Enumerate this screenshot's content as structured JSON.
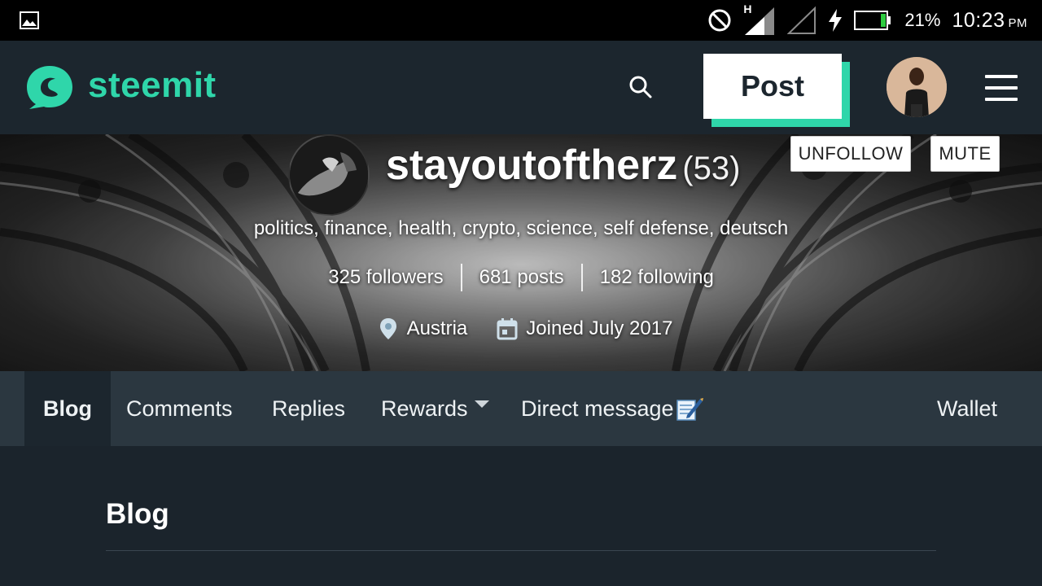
{
  "status_bar": {
    "signal_label": "H",
    "battery_percent": "21%",
    "time": "10:23",
    "ampm": "PM"
  },
  "header": {
    "logo_text": "steemit",
    "post_label": "Post",
    "accent_color": "#2fd6aa"
  },
  "profile": {
    "username": "stayoutoftherz",
    "reputation": "(53)",
    "about": "politics, finance, health, crypto, science, self defense, deutsch",
    "followers": "325 followers",
    "posts": "681 posts",
    "following": "182 following",
    "location": "Austria",
    "joined": "Joined July 2017",
    "unfollow_label": "UNFOLLOW",
    "mute_label": "MUTE"
  },
  "tabs": [
    {
      "label": "Blog"
    },
    {
      "label": "Comments"
    },
    {
      "label": "Replies"
    },
    {
      "label": "Rewards"
    },
    {
      "label": "Direct message"
    },
    {
      "label": "Wallet"
    }
  ],
  "main": {
    "section_title": "Blog"
  }
}
